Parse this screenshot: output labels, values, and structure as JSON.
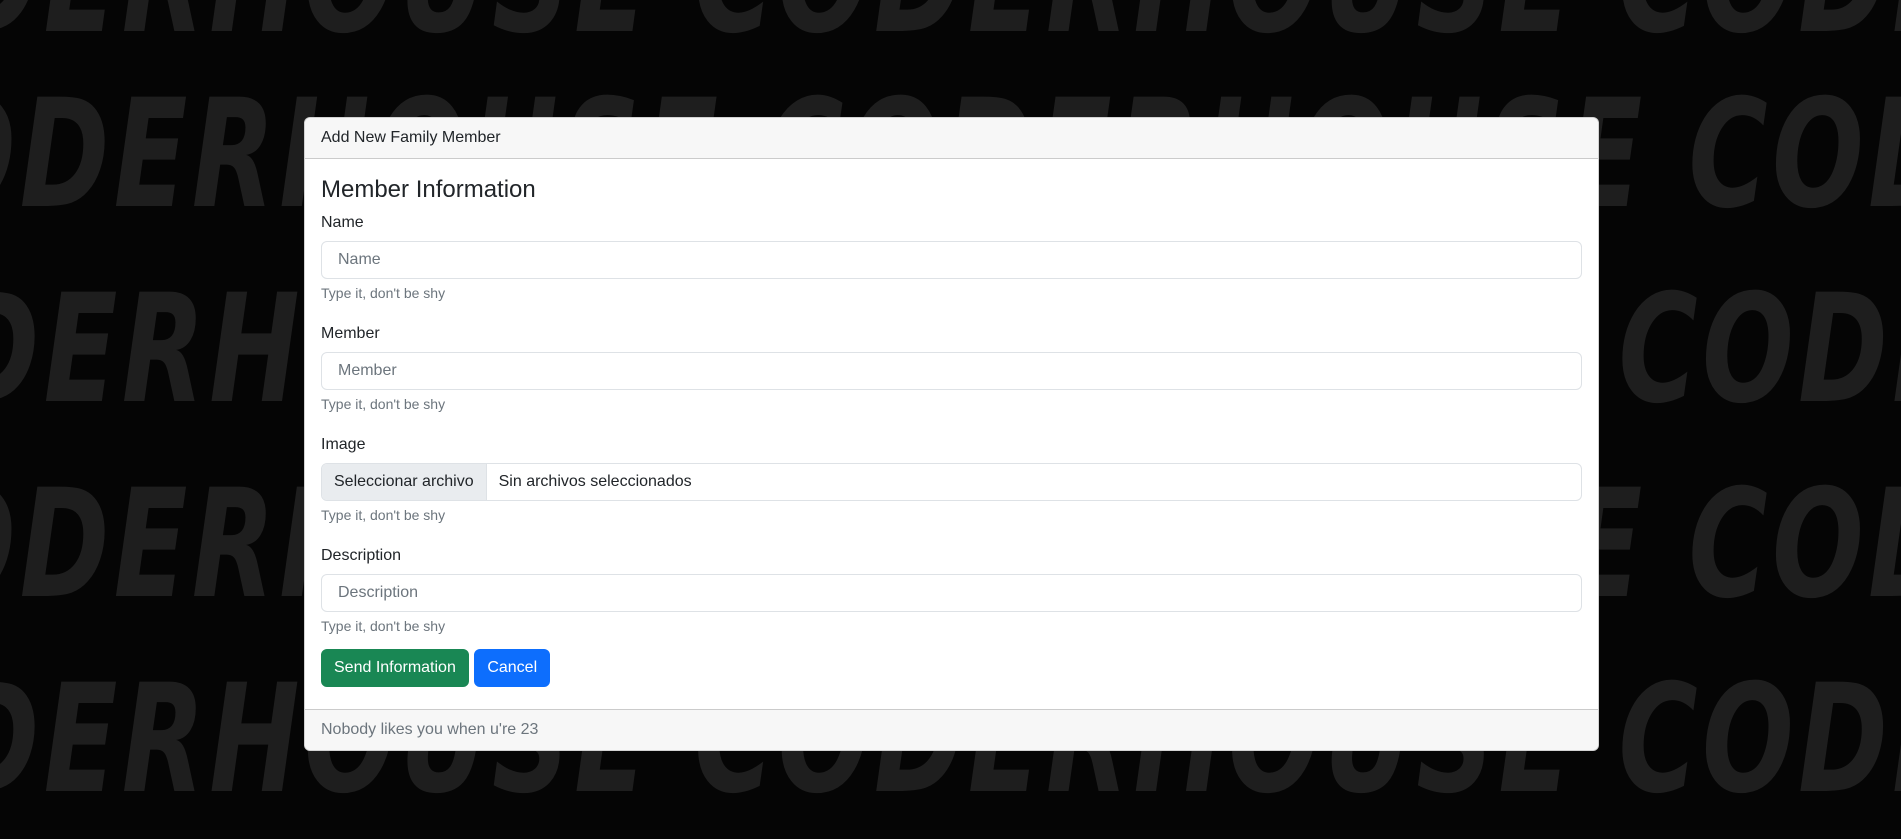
{
  "background": {
    "text": "CODERHOUSE CODERHOUSE CODERHOUSE CODERHOUSE"
  },
  "card": {
    "header": "Add New Family Member",
    "title": "Member Information",
    "fields": {
      "name": {
        "label": "Name",
        "placeholder": "Name",
        "help": "Type it, don't be shy"
      },
      "member": {
        "label": "Member",
        "placeholder": "Member",
        "help": "Type it, don't be shy"
      },
      "image": {
        "label": "Image",
        "button_label": "Seleccionar archivo",
        "status": "Sin archivos seleccionados",
        "help": "Type it, don't be shy"
      },
      "description": {
        "label": "Description",
        "placeholder": "Description",
        "help": "Type it, don't be shy"
      }
    },
    "buttons": {
      "send": "Send Information",
      "cancel": "Cancel"
    },
    "footer": "Nobody likes you when u're 23"
  },
  "colors": {
    "success": "#198754",
    "primary": "#0d6efd",
    "background": "#000000"
  }
}
